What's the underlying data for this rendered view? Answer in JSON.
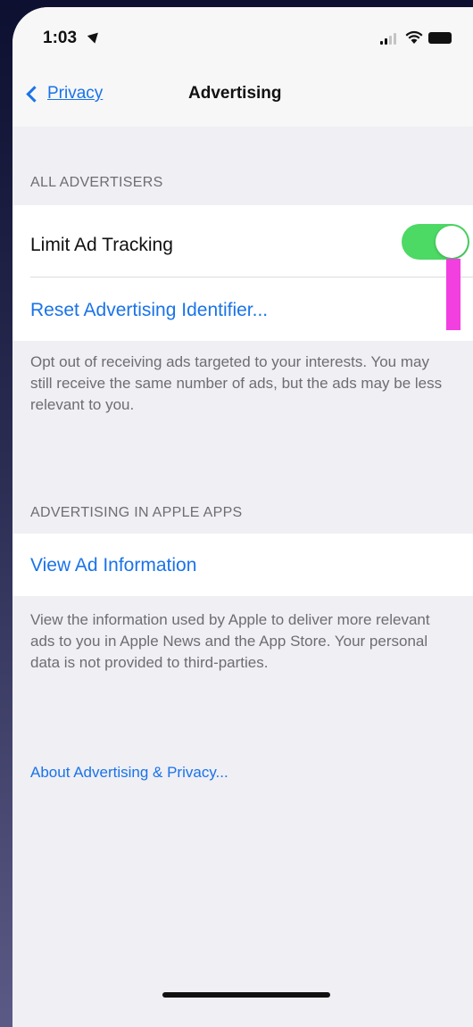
{
  "status_bar": {
    "time": "1:03",
    "icons": [
      "location-arrow-icon",
      "cellular-signal-icon",
      "wifi-icon",
      "battery-icon"
    ]
  },
  "nav": {
    "back_label": "Privacy",
    "title": "Advertising"
  },
  "sections": {
    "all_advertisers": {
      "header": "ALL ADVERTISERS",
      "limit_ad_tracking_label": "Limit Ad Tracking",
      "limit_ad_tracking_on": true,
      "reset_label": "Reset Advertising Identifier...",
      "footer": "Opt out of receiving ads targeted to your interests. You may still receive the same number of ads, but the ads may be less relevant to you."
    },
    "apple_apps": {
      "header": "ADVERTISING IN APPLE APPS",
      "view_ad_info_label": "View Ad Information",
      "footer": "View the information used by Apple to deliver more relevant ads to you in Apple News and the App Store. Your personal data is not provided to third-parties."
    }
  },
  "about_link": "About Advertising & Privacy...",
  "colors": {
    "accent": "#1a73e8",
    "toggle_on": "#4cd964",
    "annotation": "#f13fe0",
    "background": "#efeff4"
  }
}
